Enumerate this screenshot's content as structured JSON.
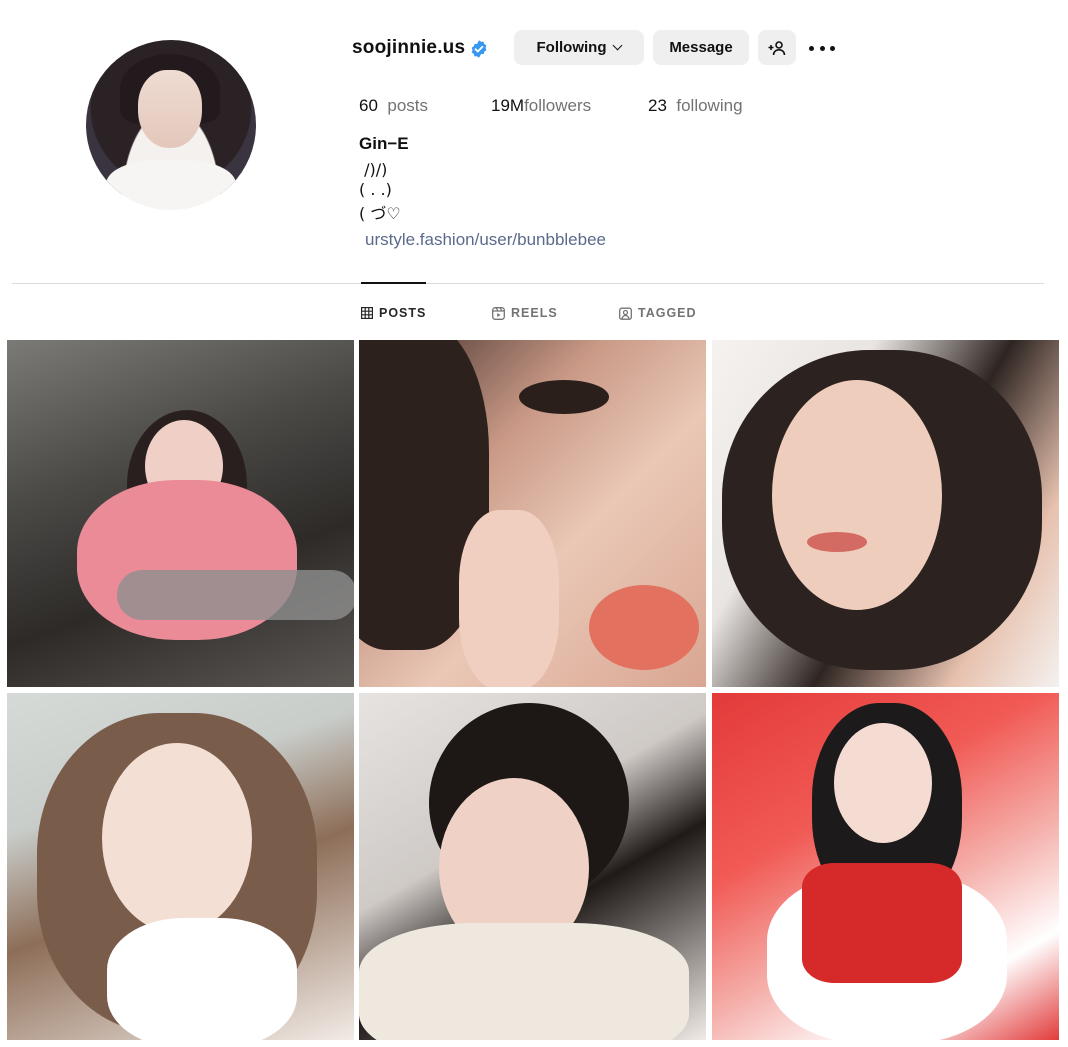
{
  "profile": {
    "username": "soojinnie.us",
    "verified": true,
    "verified_color": "#3897f0",
    "buttons": {
      "following": "Following",
      "message": "Message"
    },
    "stats": {
      "posts_count": "60",
      "posts_label": "posts",
      "followers_count": "19M",
      "followers_label": "followers",
      "following_count": "23",
      "following_label": "following"
    },
    "bio": {
      "name": "Gin−E",
      "line1": " /)/)",
      "line2": "( . .)",
      "line3": "( づ♡",
      "link": "urstyle.fashion/user/bunbblebee"
    }
  },
  "tabs": [
    {
      "label": "POSTS",
      "icon": "grid-icon",
      "active": true
    },
    {
      "label": "REELS",
      "icon": "reels-icon",
      "active": false
    },
    {
      "label": "TAGGED",
      "icon": "tagged-icon",
      "active": false
    }
  ],
  "icons": {
    "verified": "verified-badge-icon",
    "following_dropdown": "chevron-down-icon",
    "add_user": "add-user-icon",
    "more": "more-options-icon"
  },
  "colors": {
    "button_bg": "#efefef",
    "link": "#5b6a8c",
    "muted_text": "#737373"
  }
}
